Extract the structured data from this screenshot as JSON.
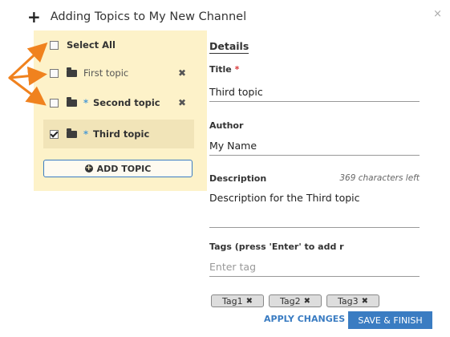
{
  "modal": {
    "title": "Adding Topics to My New Channel",
    "close_glyph": "×",
    "plus_glyph": "+"
  },
  "topics_panel": {
    "select_all_label": "Select All",
    "items": [
      {
        "label": "First topic",
        "starred": false,
        "checked": false
      },
      {
        "label": "Second topic",
        "starred": true,
        "checked": false
      },
      {
        "label": "Third topic",
        "starred": true,
        "checked": true
      }
    ],
    "star_glyph": "*",
    "remove_glyph": "✖",
    "add_topic_label": "ADD TOPIC"
  },
  "details": {
    "heading": "Details",
    "title_label": "Title",
    "required_mark": "*",
    "title_value": "Third topic",
    "author_label": "Author",
    "author_value": "My Name",
    "description_label": "Description",
    "chars_left": "369 characters left",
    "description_value": "Description for the Third topic",
    "tags_label": "Tags (press 'Enter' to add r",
    "tags_placeholder": "Enter tag",
    "tags": [
      "Tag1",
      "Tag2",
      "Tag3"
    ],
    "tag_remove_glyph": "✖"
  },
  "footer": {
    "apply_label": "APPLY CHANGES",
    "save_label": "SAVE & FINISH"
  },
  "colors": {
    "panel_bg": "#fdf2c9",
    "accent_blue": "#3a7cc2",
    "annotation_orange": "#f0821e",
    "required_red": "#d9393a"
  }
}
